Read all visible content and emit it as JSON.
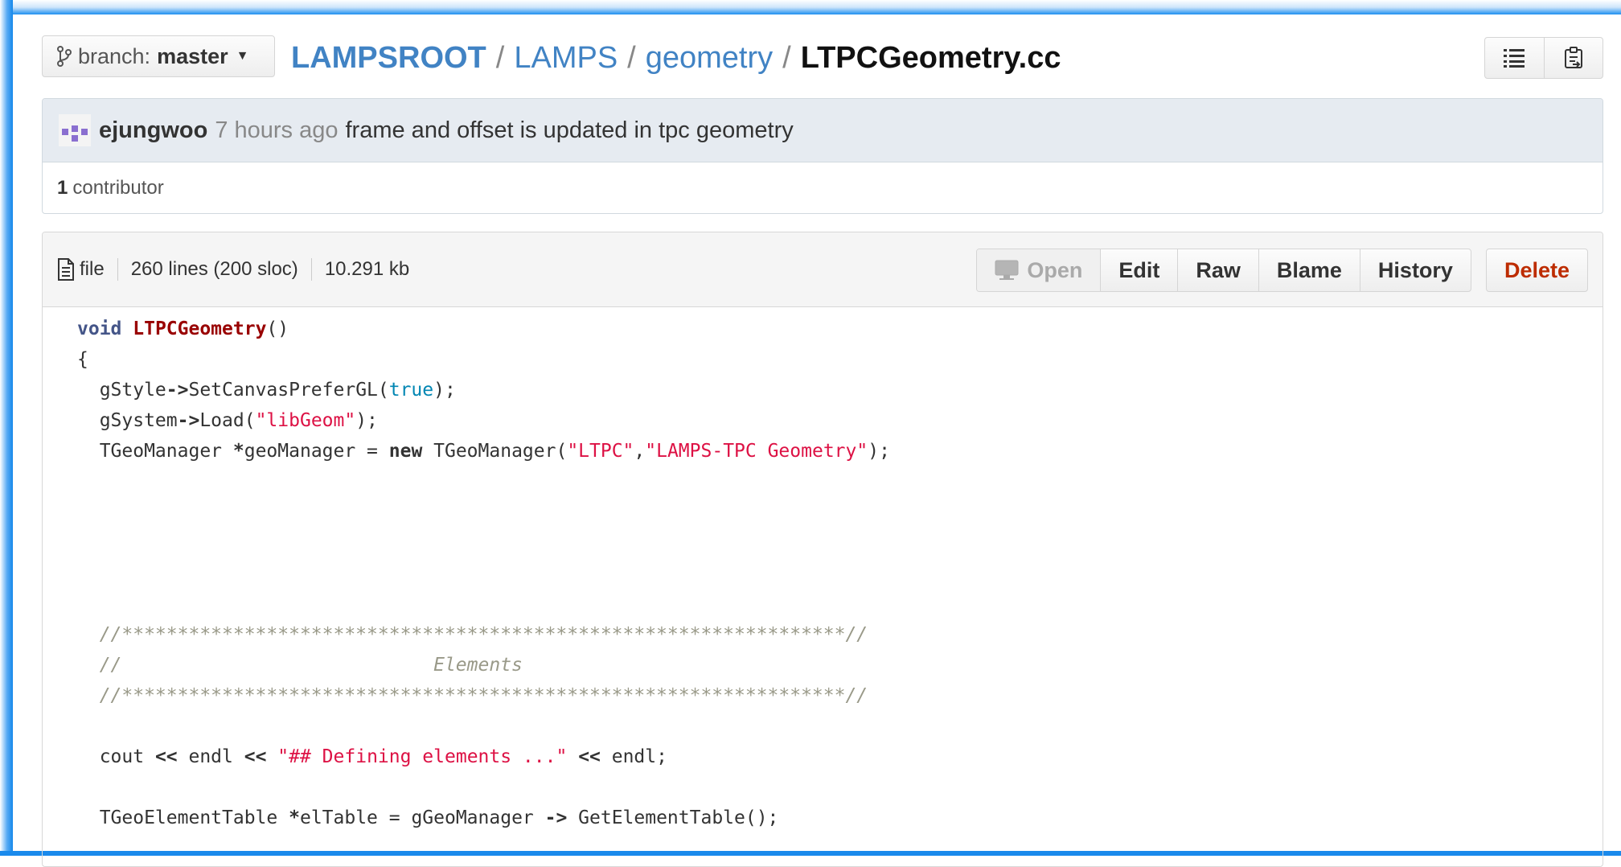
{
  "branch": {
    "prefix": "branch:",
    "name": "master"
  },
  "breadcrumb": {
    "root": "LAMPSROOT",
    "part1": "LAMPS",
    "part2": "geometry",
    "final": "LTPCGeometry.cc",
    "separator": "/"
  },
  "commit": {
    "author": "ejungwoo",
    "time": "7 hours ago",
    "message": "frame and offset is updated in tpc geometry"
  },
  "contributors": {
    "count": "1",
    "label": "contributor"
  },
  "file_info": {
    "type": "file",
    "lines": "260 lines (200 sloc)",
    "size": "10.291 kb"
  },
  "actions": {
    "open": "Open",
    "edit": "Edit",
    "raw": "Raw",
    "blame": "Blame",
    "history": "History",
    "delete": "Delete"
  },
  "colors": {
    "link": "#4183c4",
    "delete": "#bd2c00",
    "commit_bg": "#e6ebf1",
    "frame": "#1a8aec"
  },
  "icons": [
    "branch-icon",
    "caret-down-icon",
    "list-icon",
    "clipboard-icon",
    "file-icon",
    "desktop-icon"
  ],
  "code": {
    "l1": {
      "kw": "void",
      "fn": "LTPCGeometry",
      "rest": "()"
    },
    "l2": "{",
    "l3": {
      "a": "  gStyle",
      "op": "->",
      "b": "SetCanvasPreferGL(",
      "bool": "true",
      "c": ");"
    },
    "l4": {
      "a": "  gSystem",
      "op": "->",
      "b": "Load(",
      "str": "\"libGeom\"",
      "c": ");"
    },
    "l5": {
      "a": "  TGeoManager ",
      "star": "*",
      "b": "geoManager = ",
      "kw": "new",
      "c": " TGeoManager(",
      "s1": "\"LTPC\"",
      "comma": ",",
      "s2": "\"LAMPS-TPC Geometry\"",
      "d": ");"
    },
    "l11": "  //*****************************************************************//",
    "l12": "  //                            Elements",
    "l13": "  //*****************************************************************//",
    "l15": {
      "a": "  cout ",
      "op1": "<<",
      "b": " endl ",
      "op2": "<<",
      "sp": " ",
      "str": "\"## Defining elements ...\"",
      "sp2": " ",
      "op3": "<<",
      "c": " endl;"
    },
    "l17": {
      "a": "  TGeoElementTable ",
      "star": "*",
      "b": "elTable = gGeoManager ",
      "op": "->",
      "c": " GetElementTable();"
    }
  }
}
